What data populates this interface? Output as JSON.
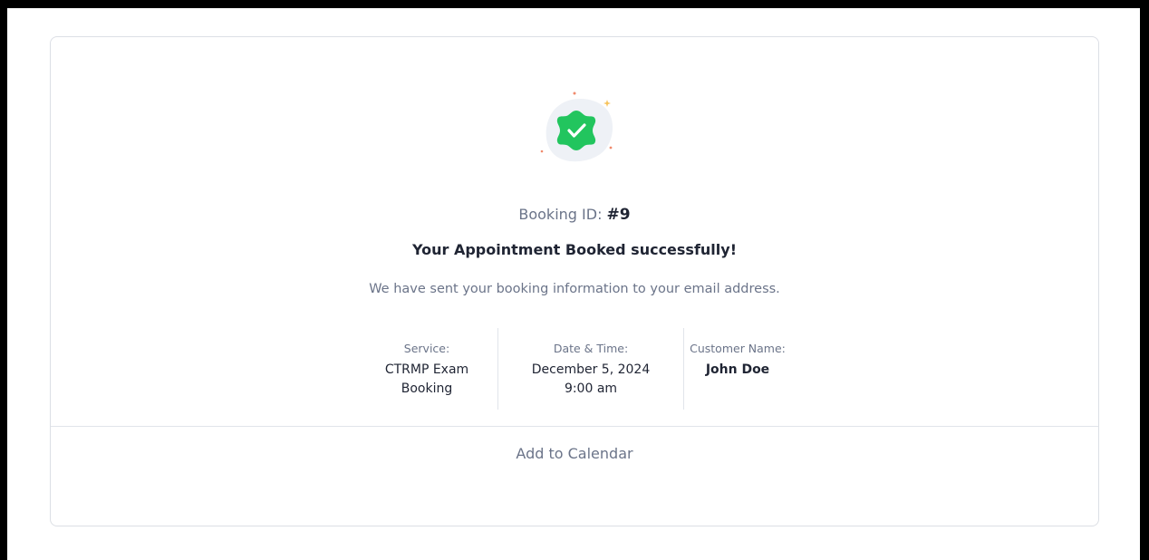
{
  "badge": {
    "icon": "verified-check-icon",
    "color": "#22c55e"
  },
  "booking": {
    "id_label": "Booking ID:",
    "id_value": "#9",
    "headline": "Your Appointment Booked successfully!",
    "subline": "We have sent your booking information to your email address."
  },
  "details": {
    "service_label": "Service:",
    "service_value": "CTRMP Exam Booking",
    "datetime_label": "Date & Time:",
    "date_value": "December 5, 2024",
    "time_value": "9:00 am",
    "customer_label": "Customer Name:",
    "customer_value": "John Doe"
  },
  "actions": {
    "calendar_label": "Add to Calendar"
  }
}
